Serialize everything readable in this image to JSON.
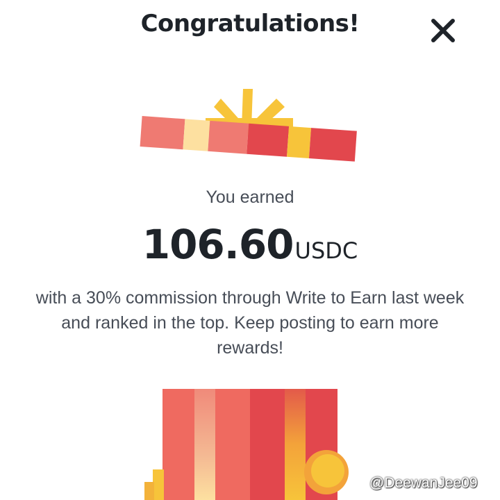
{
  "dialog": {
    "title": "Congratulations!",
    "close_icon": "close-icon",
    "earned_label": "You earned",
    "amount": "106.60",
    "currency": "USDC",
    "message": "with a 30% commission through Write to Earn last week and ranked in the top. Keep posting to earn more rewards!"
  },
  "illustration": {
    "icon": "gift-box-icon",
    "colors": {
      "red": "#e2474d",
      "pink": "#ef7a72",
      "light_yellow": "#fde0a0",
      "gold": "#f7c43a",
      "orange": "#f3a33a"
    }
  },
  "watermark": {
    "text": "@DeewanJee09",
    "icon": "binance-logo-icon"
  }
}
